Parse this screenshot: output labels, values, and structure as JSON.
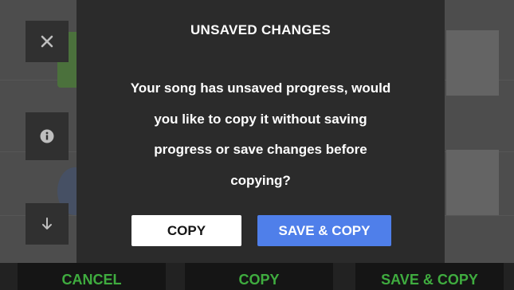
{
  "dialog": {
    "title": "UNSAVED CHANGES",
    "message_lines": [
      "Your song has unsaved progress, would",
      "you like to copy it without saving",
      "progress or save changes before",
      "copying?"
    ],
    "copy_label": "COPY",
    "save_copy_label": "SAVE & COPY"
  },
  "sidebar": {
    "close_icon": "close-icon",
    "info_icon": "info-icon",
    "download_icon": "arrow-down-icon"
  },
  "bottom_bar": {
    "cancel_label": "CANCEL",
    "copy_label": "COPY",
    "save_copy_label": "SAVE & COPY"
  },
  "colors": {
    "accent_green": "#4ed24e",
    "primary_blue": "#4f7fea",
    "dialog_bg": "#2b2b2b"
  }
}
